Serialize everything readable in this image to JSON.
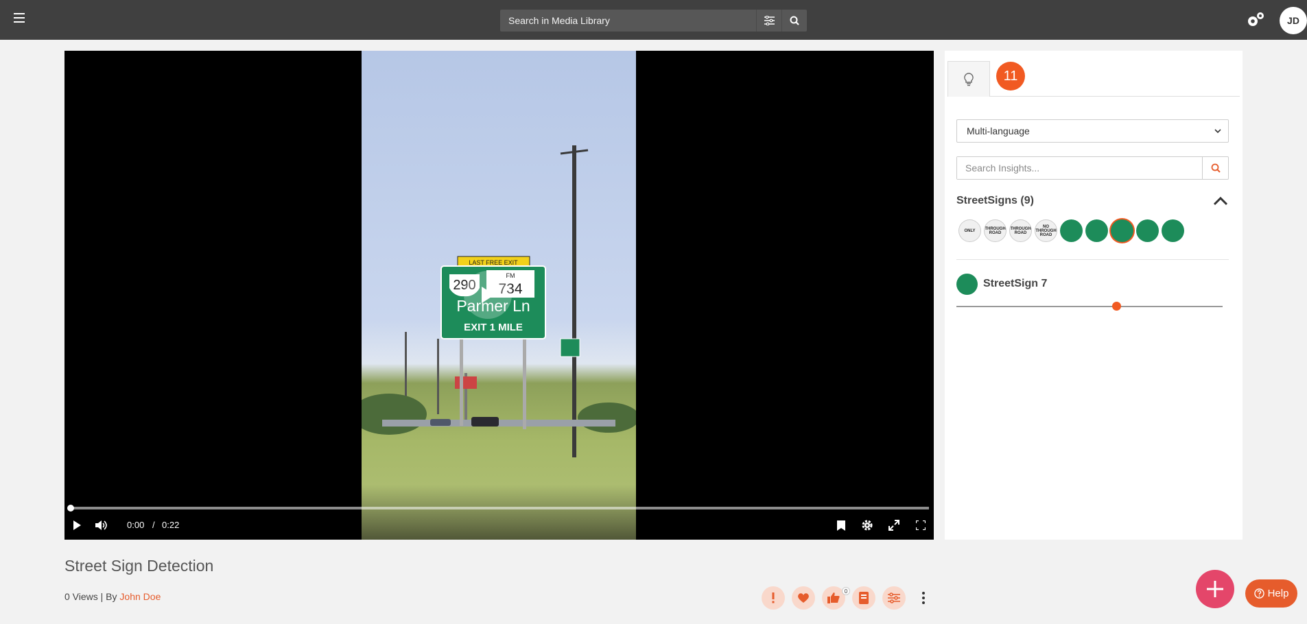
{
  "header": {
    "search_placeholder": "Search in Media Library",
    "avatar_initials": "JD"
  },
  "video": {
    "current_time": "0:00",
    "separator": "/",
    "duration": "0:22",
    "progress_fraction": 0.0
  },
  "scene": {
    "top_banner": "LAST FREE EXIT",
    "route_us": "290",
    "route_fm_label": "FM",
    "route_fm": "734",
    "street": "Parmer Ln",
    "exit": "EXIT 1 MILE"
  },
  "media": {
    "title": "Street Sign Detection",
    "views": "0 Views | By",
    "author": "John Doe",
    "like_count": "0"
  },
  "insights": {
    "count": "11",
    "language": "Multi-language",
    "search_placeholder": "Search Insights...",
    "section_title": "StreetSigns (9)",
    "thumbnails": [
      {
        "label": "ONLY",
        "style": "white"
      },
      {
        "label": "THROUGH ROAD",
        "style": "white"
      },
      {
        "label": "THROUGH ROAD",
        "style": "white"
      },
      {
        "label": "NO THROUGH ROAD",
        "style": "white"
      },
      {
        "label": "",
        "style": "green"
      },
      {
        "label": "",
        "style": "green"
      },
      {
        "label": "",
        "style": "green",
        "selected": true
      },
      {
        "label": "",
        "style": "green"
      },
      {
        "label": "",
        "style": "green"
      }
    ],
    "selected_name": "StreetSign 7",
    "slider_fraction": 0.6
  },
  "help_label": "Help",
  "colors": {
    "accent": "#f15a22",
    "topbar": "#404040",
    "fab": "#e4466a",
    "sign_green": "#1d8c5a"
  }
}
